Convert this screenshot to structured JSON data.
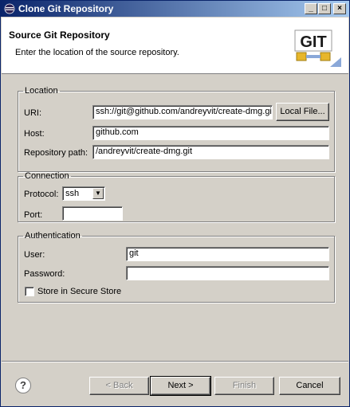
{
  "window": {
    "title": "Clone Git Repository",
    "controls": {
      "minimize": "_",
      "maximize": "□",
      "close": "×"
    }
  },
  "header": {
    "title": "Source Git Repository",
    "description": "Enter the location of the source repository.",
    "logo_text": "GIT"
  },
  "location": {
    "legend": "Location",
    "uri_label": "URI:",
    "uri_value": "ssh://git@github.com/andreyvit/create-dmg.git",
    "local_file_button": "Local File...",
    "host_label": "Host:",
    "host_value": "github.com",
    "repo_path_label": "Repository path:",
    "repo_path_value": "/andreyvit/create-dmg.git"
  },
  "connection": {
    "legend": "Connection",
    "protocol_label": "Protocol:",
    "protocol_value": "ssh",
    "port_label": "Port:",
    "port_value": ""
  },
  "authentication": {
    "legend": "Authentication",
    "user_label": "User:",
    "user_value": "git",
    "password_label": "Password:",
    "password_value": "",
    "store_label": "Store in Secure Store",
    "store_checked": false
  },
  "footer": {
    "help": "?",
    "back_button": "< Back",
    "next_button": "Next >",
    "finish_button": "Finish",
    "cancel_button": "Cancel"
  }
}
